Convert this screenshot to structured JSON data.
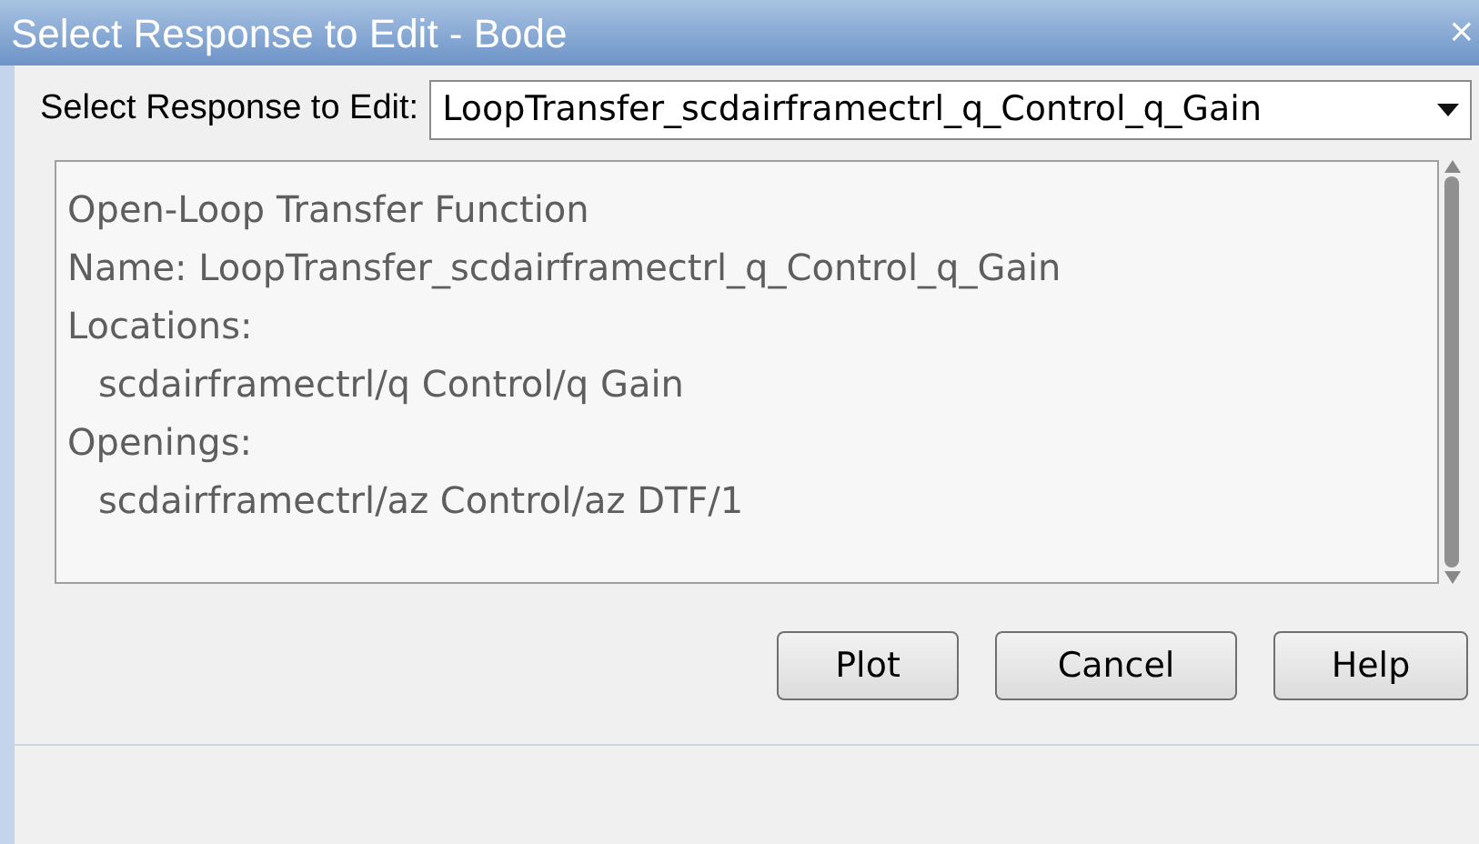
{
  "window": {
    "title": "Select Response to Edit - Bode",
    "close": "×"
  },
  "selector": {
    "label": "Select Response to Edit:",
    "value": "LoopTransfer_scdairframectrl_q_Control_q_Gain"
  },
  "details": {
    "lines": [
      {
        "text": "Open-Loop Transfer Function",
        "indented": false
      },
      {
        "text": "Name: LoopTransfer_scdairframectrl_q_Control_q_Gain",
        "indented": false
      },
      {
        "text": "Locations:",
        "indented": false
      },
      {
        "text": "scdairframectrl/q Control/q Gain",
        "indented": true
      },
      {
        "text": "Openings:",
        "indented": false
      },
      {
        "text": "scdairframectrl/az Control/az DTF/1",
        "indented": true
      }
    ]
  },
  "buttons": [
    "Plot",
    "Cancel",
    "Help"
  ]
}
